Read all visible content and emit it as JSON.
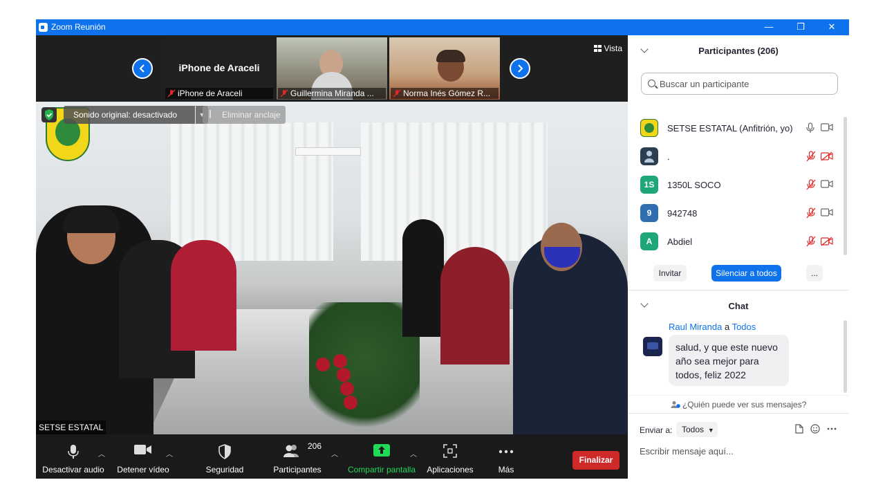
{
  "window": {
    "title": "Zoom Reunión",
    "minimize": "—",
    "restore": "❐",
    "close": "✕"
  },
  "strip": {
    "tiles": [
      {
        "big_name": "iPhone de Araceli",
        "label": "iPhone de Araceli"
      },
      {
        "label": "Guillermina Miranda ..."
      },
      {
        "label": "Norma Inés Gómez R..."
      }
    ],
    "view_label": "Vista"
  },
  "main_video": {
    "original_sound": "Sonido original: desactivado",
    "unpin_label": "Eliminar anclaje",
    "speaker_name": "SETSE ESTATAL"
  },
  "toolbar": {
    "mute_label": "Desactivar audio",
    "video_label": "Detener vídeo",
    "security_label": "Seguridad",
    "participants_label": "Participantes",
    "participants_count": "206",
    "share_label": "Compartir pantalla",
    "apps_label": "Aplicaciones",
    "more_label": "Más",
    "end_label": "Finalizar",
    "share_color": "#23d959",
    "end_color": "#cf2a2a"
  },
  "participants": {
    "title": "Participantes (206)",
    "search_placeholder": "Buscar un participante",
    "items": [
      {
        "initials": "",
        "name": "SETSE ESTATAL (Anfitrión, yo)",
        "avatar_color": "#f2d61a",
        "muted": false
      },
      {
        "initials": "",
        "name": ".",
        "avatar_color": "#2c3e50",
        "muted": true
      },
      {
        "initials": "1S",
        "name": "1350L SOCO",
        "avatar_color": "#1fa67a",
        "muted": true
      },
      {
        "initials": "9",
        "name": "942748",
        "avatar_color": "#2f6fb0",
        "muted": true
      },
      {
        "initials": "A",
        "name": "Abdiel",
        "avatar_color": "#1fa67a",
        "muted": true
      }
    ],
    "invite_label": "Invitar",
    "mute_all_label": "Silenciar a todos",
    "more_label": "..."
  },
  "chat": {
    "title": "Chat",
    "messages": [
      {
        "from": "Raul Miranda",
        "to_word": "a",
        "to": "Todos",
        "text": "salud, y que este nuevo año sea mejor para todos, feliz 2022"
      }
    ],
    "who_can_see": "¿Quién puede ver sus mensajes?",
    "send_to_label": "Enviar a:",
    "send_to_value": "Todos",
    "input_placeholder": "Escribir mensaje aquí..."
  },
  "accent_color": "#0e72ed"
}
